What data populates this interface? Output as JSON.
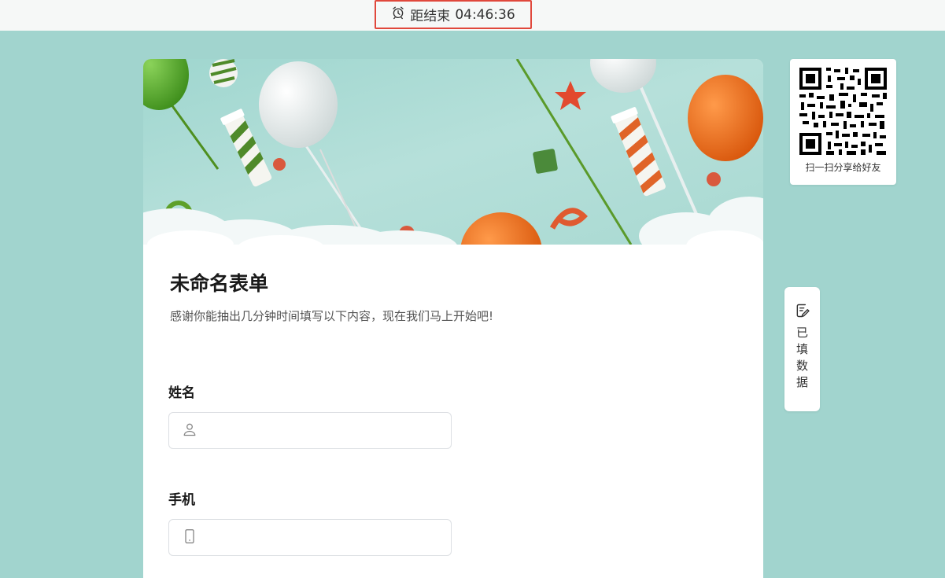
{
  "timer": {
    "icon": "alarm-clock-icon",
    "prefix": "距结束",
    "time": "04:46:36"
  },
  "form": {
    "title": "未命名表单",
    "description": "感谢你能抽出几分钟时间填写以下内容，现在我们马上开始吧!",
    "fields": [
      {
        "label": "姓名",
        "icon": "user-icon",
        "value": ""
      },
      {
        "label": "手机",
        "icon": "phone-icon",
        "value": ""
      }
    ]
  },
  "share": {
    "caption": "扫一扫分享给好友"
  },
  "side_tab": {
    "icon": "edit-note-icon",
    "label": "已填数据"
  },
  "colors": {
    "page_background": "#a1d4ce",
    "timer_border": "#e0483c"
  }
}
